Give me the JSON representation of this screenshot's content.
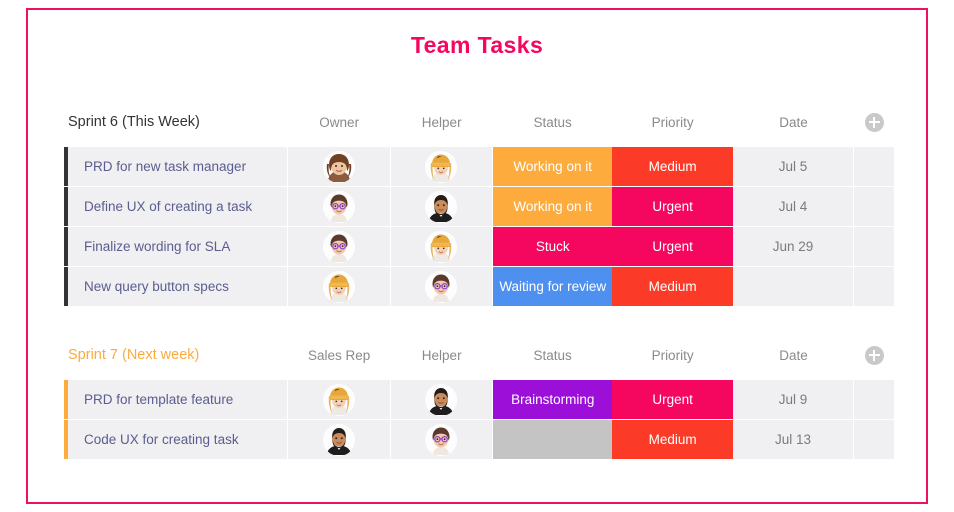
{
  "page": {
    "title": "Team Tasks",
    "title_color": "#f5075f",
    "border_color": "#ed1164",
    "background": "#ffffff"
  },
  "icons": {
    "add_column": "plus-circle-icon"
  },
  "status_colors": {
    "Working on it": "#fdab3d",
    "Stuck": "#f5075f",
    "Waiting for review": "#4d90f0",
    "Brainstorming": "#9b0fd9",
    "": "#c4c4c4"
  },
  "priority_colors": {
    "Medium": "#fb3b28",
    "Urgent": "#f5075f"
  },
  "boards": [
    {
      "group_label": "Sprint 6 (This Week)",
      "group_color": "#333333",
      "accent_color": "#333333",
      "columns": [
        "Owner",
        "Helper",
        "Status",
        "Priority",
        "Date"
      ],
      "add_button_label": "+",
      "rows": [
        {
          "name": "PRD for new task manager",
          "owner": "woman-brown-wavy-hair-avatar",
          "helper": "woman-orange-beanie-avatar",
          "status": "Working on it",
          "priority": "Medium",
          "date": "Jul 5"
        },
        {
          "name": "Define UX of creating a task",
          "owner": "woman-glasses-short-hair-avatar",
          "helper": "man-beard-black-shirt-avatar",
          "status": "Working on it",
          "priority": "Urgent",
          "date": "Jul 4"
        },
        {
          "name": "Finalize wording for SLA",
          "owner": "woman-glasses-short-hair-avatar",
          "helper": "woman-orange-beanie-avatar",
          "status": "Stuck",
          "priority": "Urgent",
          "date": "Jun 29"
        },
        {
          "name": "New query button specs",
          "owner": "woman-orange-beanie-avatar",
          "helper": "woman-glasses-short-hair-avatar",
          "status": "Waiting for review",
          "priority": "Medium",
          "date": ""
        }
      ]
    },
    {
      "group_label": "Sprint 7 (Next week)",
      "group_color": "#fdab3d",
      "accent_color": "#fdab3d",
      "columns": [
        "Sales Rep",
        "Helper",
        "Status",
        "Priority",
        "Date"
      ],
      "add_button_label": "+",
      "rows": [
        {
          "name": "PRD for template feature",
          "owner": "woman-orange-beanie-avatar",
          "helper": "man-beard-black-shirt-avatar",
          "status": "Brainstorming",
          "priority": "Urgent",
          "date": "Jul 9"
        },
        {
          "name": "Code UX for creating task",
          "owner": "man-beard-black-shirt-avatar",
          "helper": "woman-glasses-short-hair-avatar",
          "status": "",
          "priority": "Medium",
          "date": "Jul 13"
        }
      ]
    }
  ]
}
